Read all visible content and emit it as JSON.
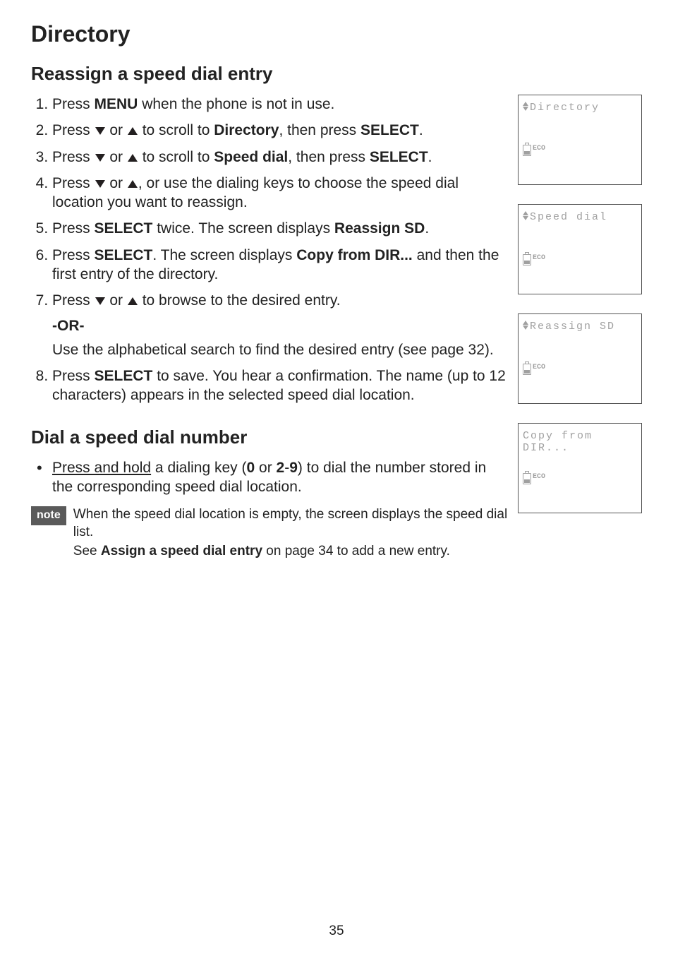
{
  "page_title": "Directory",
  "section1": {
    "heading": "Reassign a speed dial entry",
    "steps": {
      "s1_a": "Press ",
      "s1_b": "MENU",
      "s1_c": " when the phone is not in use.",
      "s2_a": "Press ",
      "s2_b": " or ",
      "s2_c": " to scroll to ",
      "s2_d": "Directory",
      "s2_e": ", then press ",
      "s2_f": "SELECT",
      "s2_g": ".",
      "s3_a": "Press ",
      "s3_b": " or ",
      "s3_c": " to scroll to ",
      "s3_d": "Speed dial",
      "s3_e": ", then press ",
      "s3_f": "SELECT",
      "s3_g": ".",
      "s4_a": "Press ",
      "s4_b": " or ",
      "s4_c": ", or use the dialing keys to choose the speed dial location you want to reassign.",
      "s5_a": "Press ",
      "s5_b": "SELECT",
      "s5_c": " twice. The screen displays ",
      "s5_d": "Reassign SD",
      "s5_e": ".",
      "s6_a": "Press ",
      "s6_b": "SELECT",
      "s6_c": ". The screen displays ",
      "s6_d": "Copy from DIR...",
      "s6_e": " and then the first entry of the directory.",
      "s7_a": "Press ",
      "s7_b": " or ",
      "s7_c": " to browse to the desired entry.",
      "or_label": "-OR-",
      "alt_text": "Use the alphabetical search to find the desired entry (see page 32).",
      "s8_a": "Press ",
      "s8_b": "SELECT",
      "s8_c": " to save. You hear a confirmation. The name (up to 12 characters) appears in the selected speed dial location."
    }
  },
  "section2": {
    "heading": "Dial a speed dial number",
    "bullet": {
      "a": "Press and hold",
      "b": " a dialing key (",
      "c": "0",
      "d": " or ",
      "e": "2",
      "f": "-",
      "g": "9",
      "h": ") to dial the number stored in the corresponding speed dial location."
    }
  },
  "note": {
    "tag": "note",
    "line1": "When the speed dial location is empty, the screen displays the speed dial list.",
    "line2_a": "See ",
    "line2_b": "Assign a speed dial entry",
    "line2_c": " on page 34 to add a new entry."
  },
  "screens": {
    "eco": "ECO",
    "s1": "Directory",
    "s2": "Speed dial",
    "s3": "Reassign SD",
    "s4": "Copy from DIR..."
  },
  "page_number": "35"
}
